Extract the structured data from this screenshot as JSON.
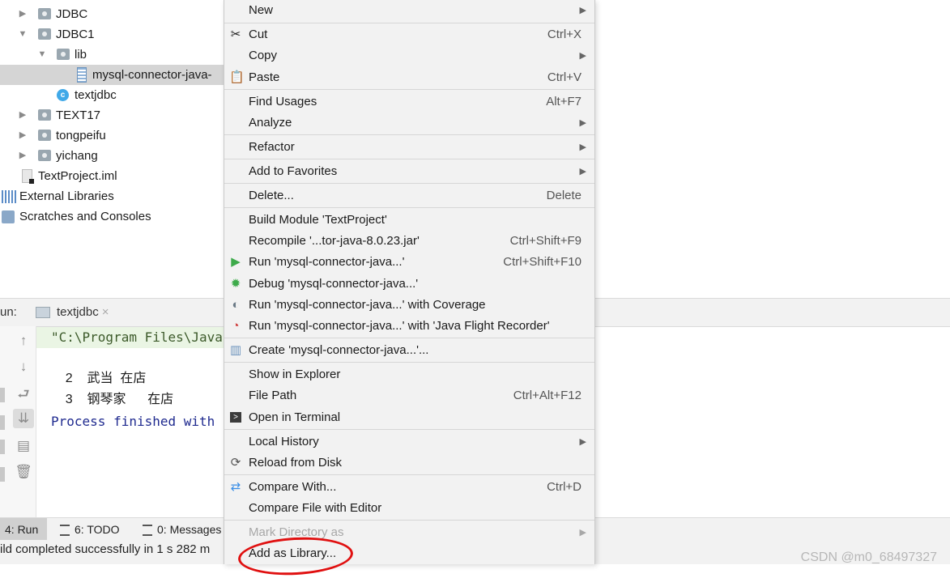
{
  "tree": {
    "items": [
      {
        "label": "JDBC"
      },
      {
        "label": "JDBC1"
      },
      {
        "label": "lib"
      },
      {
        "label": "mysql-connector-java-"
      },
      {
        "label": "textjdbc"
      },
      {
        "label": "TEXT17"
      },
      {
        "label": "tongpeifu"
      },
      {
        "label": "yichang"
      },
      {
        "label": "TextProject.iml"
      },
      {
        "label": "External Libraries"
      },
      {
        "label": "Scratches and Consoles"
      }
    ]
  },
  "run_panel": {
    "label": "un:",
    "tab_label": "textjdbc",
    "tab_close": "×"
  },
  "console": {
    "command": "\"C:\\Program Files\\Java",
    "rows": [
      {
        "num": "2",
        "name": "武当",
        "status": "在店"
      },
      {
        "num": "3",
        "name": "钢琴家",
        "status": "在店"
      }
    ],
    "process": "Process finished with"
  },
  "bottom_tabs": [
    {
      "label": "4: Run"
    },
    {
      "label": "6: TODO"
    },
    {
      "label": "0: Messages"
    }
  ],
  "status_bar": {
    "text": "ild completed successfully in 1 s 282 m"
  },
  "watermark": "CSDN @m0_68497327",
  "menu": {
    "items": [
      {
        "label": "New",
        "shortcut": "",
        "submenu": true
      },
      {
        "label": "Cut",
        "shortcut": "Ctrl+X",
        "icon": "scissors-icon"
      },
      {
        "label": "Copy",
        "shortcut": "",
        "submenu": true
      },
      {
        "label": "Paste",
        "shortcut": "Ctrl+V",
        "icon": "clipboard-icon"
      },
      {
        "label": "Find Usages",
        "shortcut": "Alt+F7"
      },
      {
        "label": "Analyze",
        "shortcut": "",
        "submenu": true
      },
      {
        "label": "Refactor",
        "shortcut": "",
        "submenu": true
      },
      {
        "label": "Add to Favorites",
        "shortcut": "",
        "submenu": true
      },
      {
        "label": "Delete...",
        "shortcut": "Delete"
      },
      {
        "label": "Build Module 'TextProject'",
        "shortcut": ""
      },
      {
        "label": "Recompile '...tor-java-8.0.23.jar'",
        "shortcut": "Ctrl+Shift+F9"
      },
      {
        "label": "Run 'mysql-connector-java...'",
        "shortcut": "Ctrl+Shift+F10",
        "icon": "run-icon"
      },
      {
        "label": "Debug 'mysql-connector-java...'",
        "shortcut": "",
        "icon": "debug-icon"
      },
      {
        "label": "Run 'mysql-connector-java...' with Coverage",
        "shortcut": "",
        "icon": "coverage-icon"
      },
      {
        "label": "Run 'mysql-connector-java...' with 'Java Flight Recorder'",
        "shortcut": "",
        "icon": "flight-recorder-icon"
      },
      {
        "label": "Create 'mysql-connector-java...'...",
        "shortcut": "",
        "icon": "jar-icon"
      },
      {
        "label": "Show in Explorer",
        "shortcut": ""
      },
      {
        "label": "File Path",
        "shortcut": "Ctrl+Alt+F12"
      },
      {
        "label": "Open in Terminal",
        "shortcut": "",
        "icon": "terminal-icon"
      },
      {
        "label": "Local History",
        "shortcut": "",
        "submenu": true
      },
      {
        "label": "Reload from Disk",
        "shortcut": "",
        "icon": "reload-icon"
      },
      {
        "label": "Compare With...",
        "shortcut": "Ctrl+D",
        "icon": "compare-icon"
      },
      {
        "label": "Compare File with Editor",
        "shortcut": ""
      },
      {
        "label": "Mark Directory as",
        "shortcut": "",
        "submenu": true,
        "disabled": true
      },
      {
        "label": "Add as Library...",
        "shortcut": ""
      }
    ],
    "submenu_arrow": "▶"
  },
  "colors": {
    "menu_bg": "#f2f2f2",
    "selection": "#d5d5d5",
    "annotation": "#e01010",
    "console_blue": "#1f2a8f",
    "run_green": "#3daa4a"
  }
}
